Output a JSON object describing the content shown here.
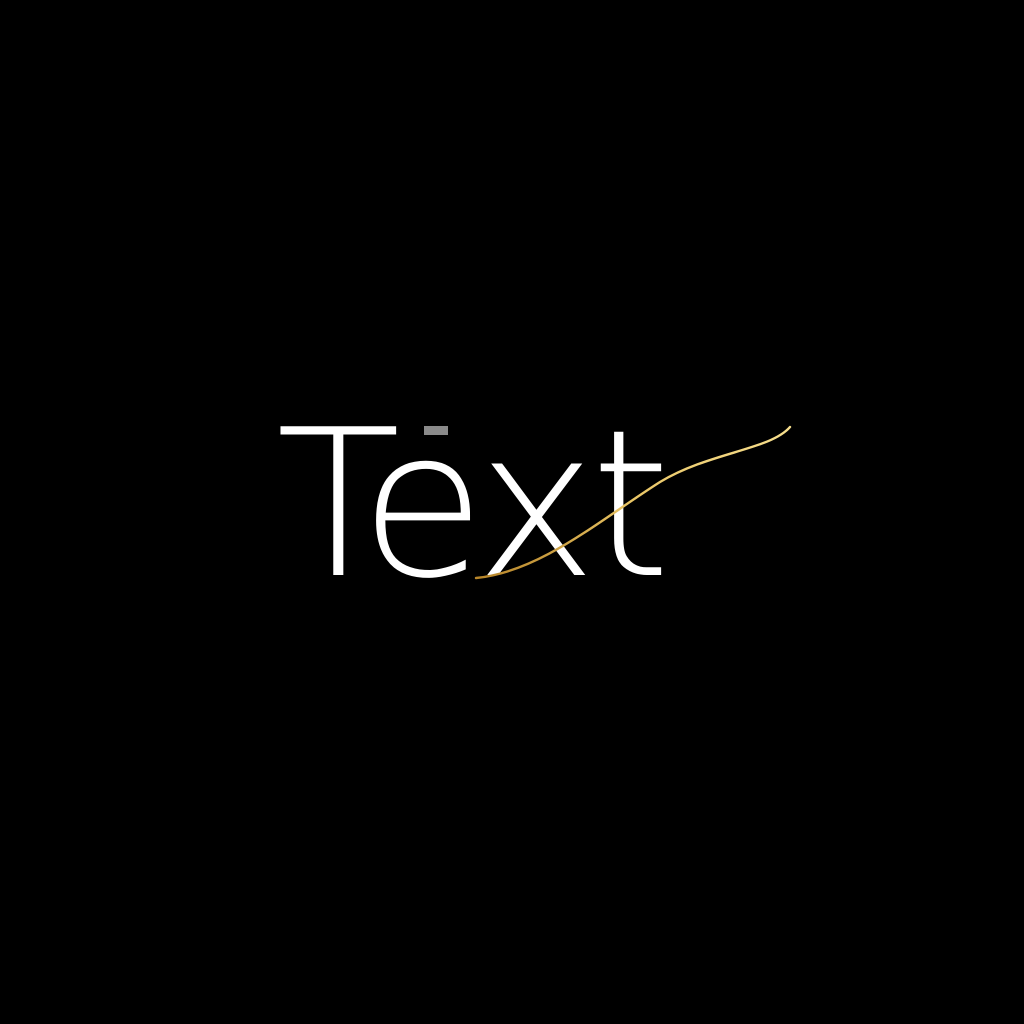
{
  "wordmark": {
    "text": "Text"
  },
  "colors": {
    "background": "#000000",
    "text": "#ffffff",
    "accent": "#d8b24a",
    "accent_light": "#f3d98a",
    "cap_tip": "#8a8a8a"
  }
}
